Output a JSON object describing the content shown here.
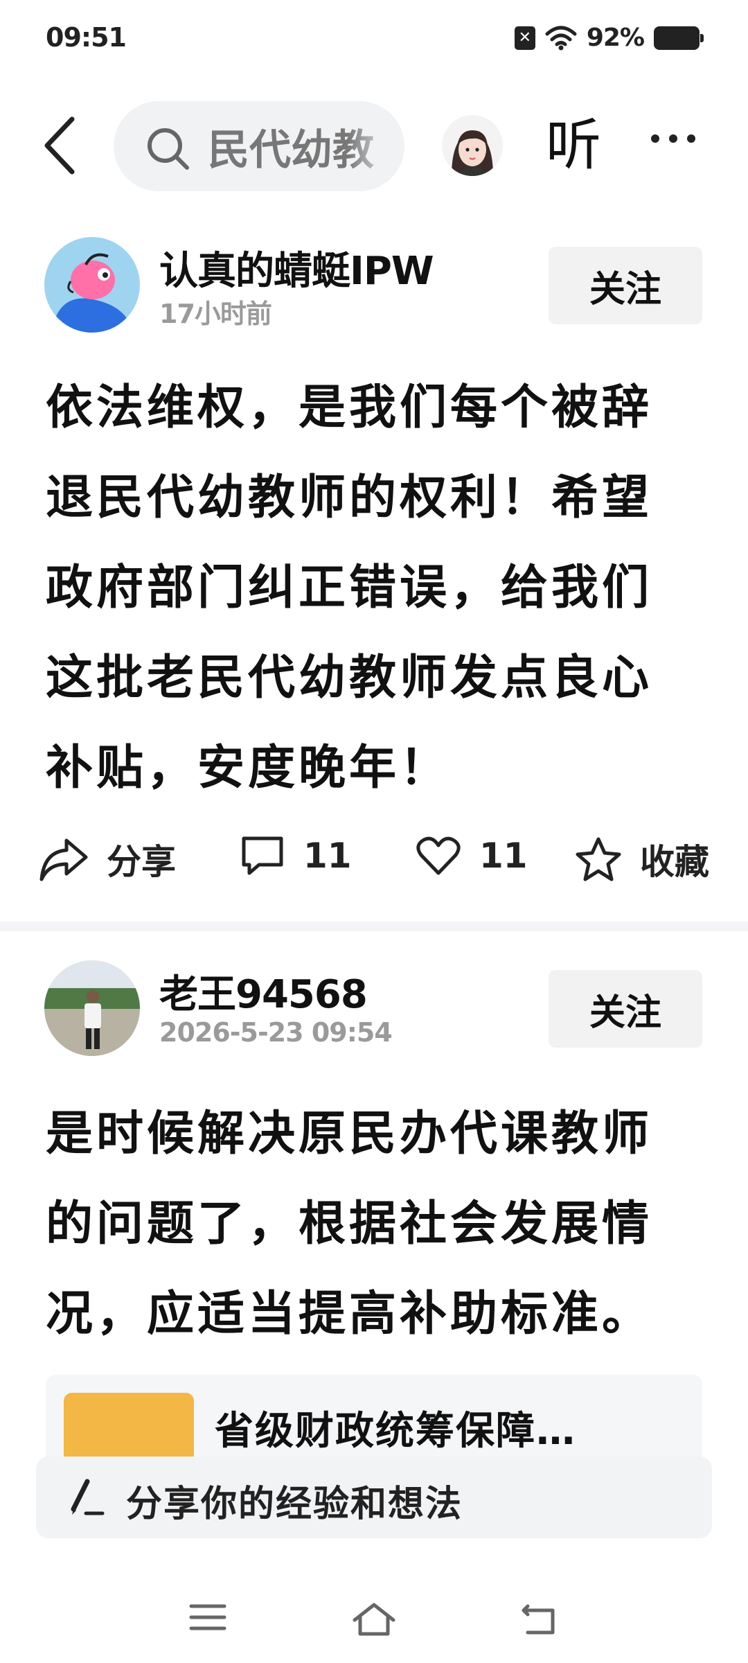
{
  "status": {
    "time": "09:51",
    "battery": "92%"
  },
  "topbar": {
    "search_text": "民代幼教",
    "listen_label": "听"
  },
  "posts": [
    {
      "author": "认真的蜻蜓IPW",
      "time": "17小时前",
      "follow_label": "关注",
      "body_lines": [
        "依法维权，是我们每个被辞",
        "退民代幼教师的权利！希望",
        "政府部门纠正错误，给我们",
        "这批老民代幼教师发点良心",
        "补贴，安度晚年！"
      ],
      "share_label": "分享",
      "comments": "11",
      "likes": "11",
      "favorite_label": "收藏"
    },
    {
      "author": "老王94568",
      "time": "2026-5-23  09:54",
      "follow_label": "关注",
      "body_lines": [
        "是时候解决原民办代课教师",
        "的问题了，根据社会发展情",
        "况，应适当提高补助标准。"
      ],
      "link_title": "省级财政统筹保障…"
    }
  ],
  "comment_bar": {
    "placeholder": "分享你的经验和想法"
  },
  "colors": {
    "background": "#ffffff",
    "button_bg": "#f2f2f2",
    "meta_text": "#9a9a9a"
  }
}
